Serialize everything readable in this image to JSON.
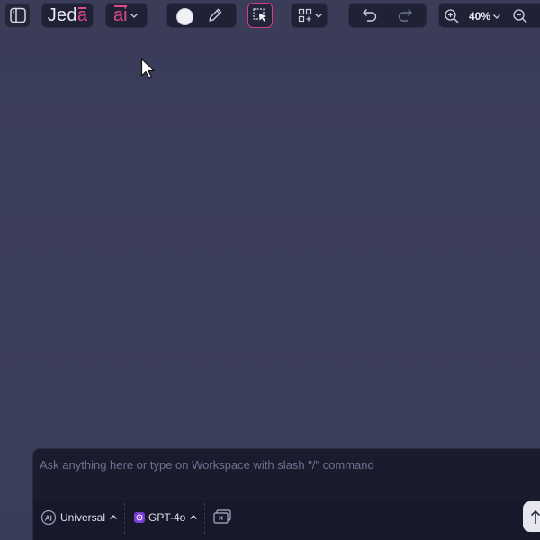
{
  "toolbar": {
    "logo_prefix": "Jed",
    "logo_accent": "a",
    "ai_label": "ai",
    "zoom_level": "40%"
  },
  "prompt": {
    "placeholder": "Ask anything here or type on Workspace with slash \"/\" command",
    "value": "",
    "mode_label": "Universal",
    "model_label": "GPT-4o"
  },
  "icons": {
    "sidebar": "sidebar-toggle-icon",
    "pencil": "pencil-icon",
    "select": "selection-cursor-icon",
    "shapes": "shapes-grid-icon",
    "undo": "undo-icon",
    "redo": "redo-icon",
    "zoom_in": "zoom-in-icon",
    "zoom_out": "zoom-out-icon",
    "clear": "clear-chat-icon",
    "send": "send-arrow-icon"
  },
  "colors": {
    "canvas": "#3c3f5c",
    "toolbar_bg": "#1f2135",
    "accent": "#e04a8c",
    "panel_bg": "#1a1c2e",
    "current_stroke_color": "#f0f0f5"
  }
}
